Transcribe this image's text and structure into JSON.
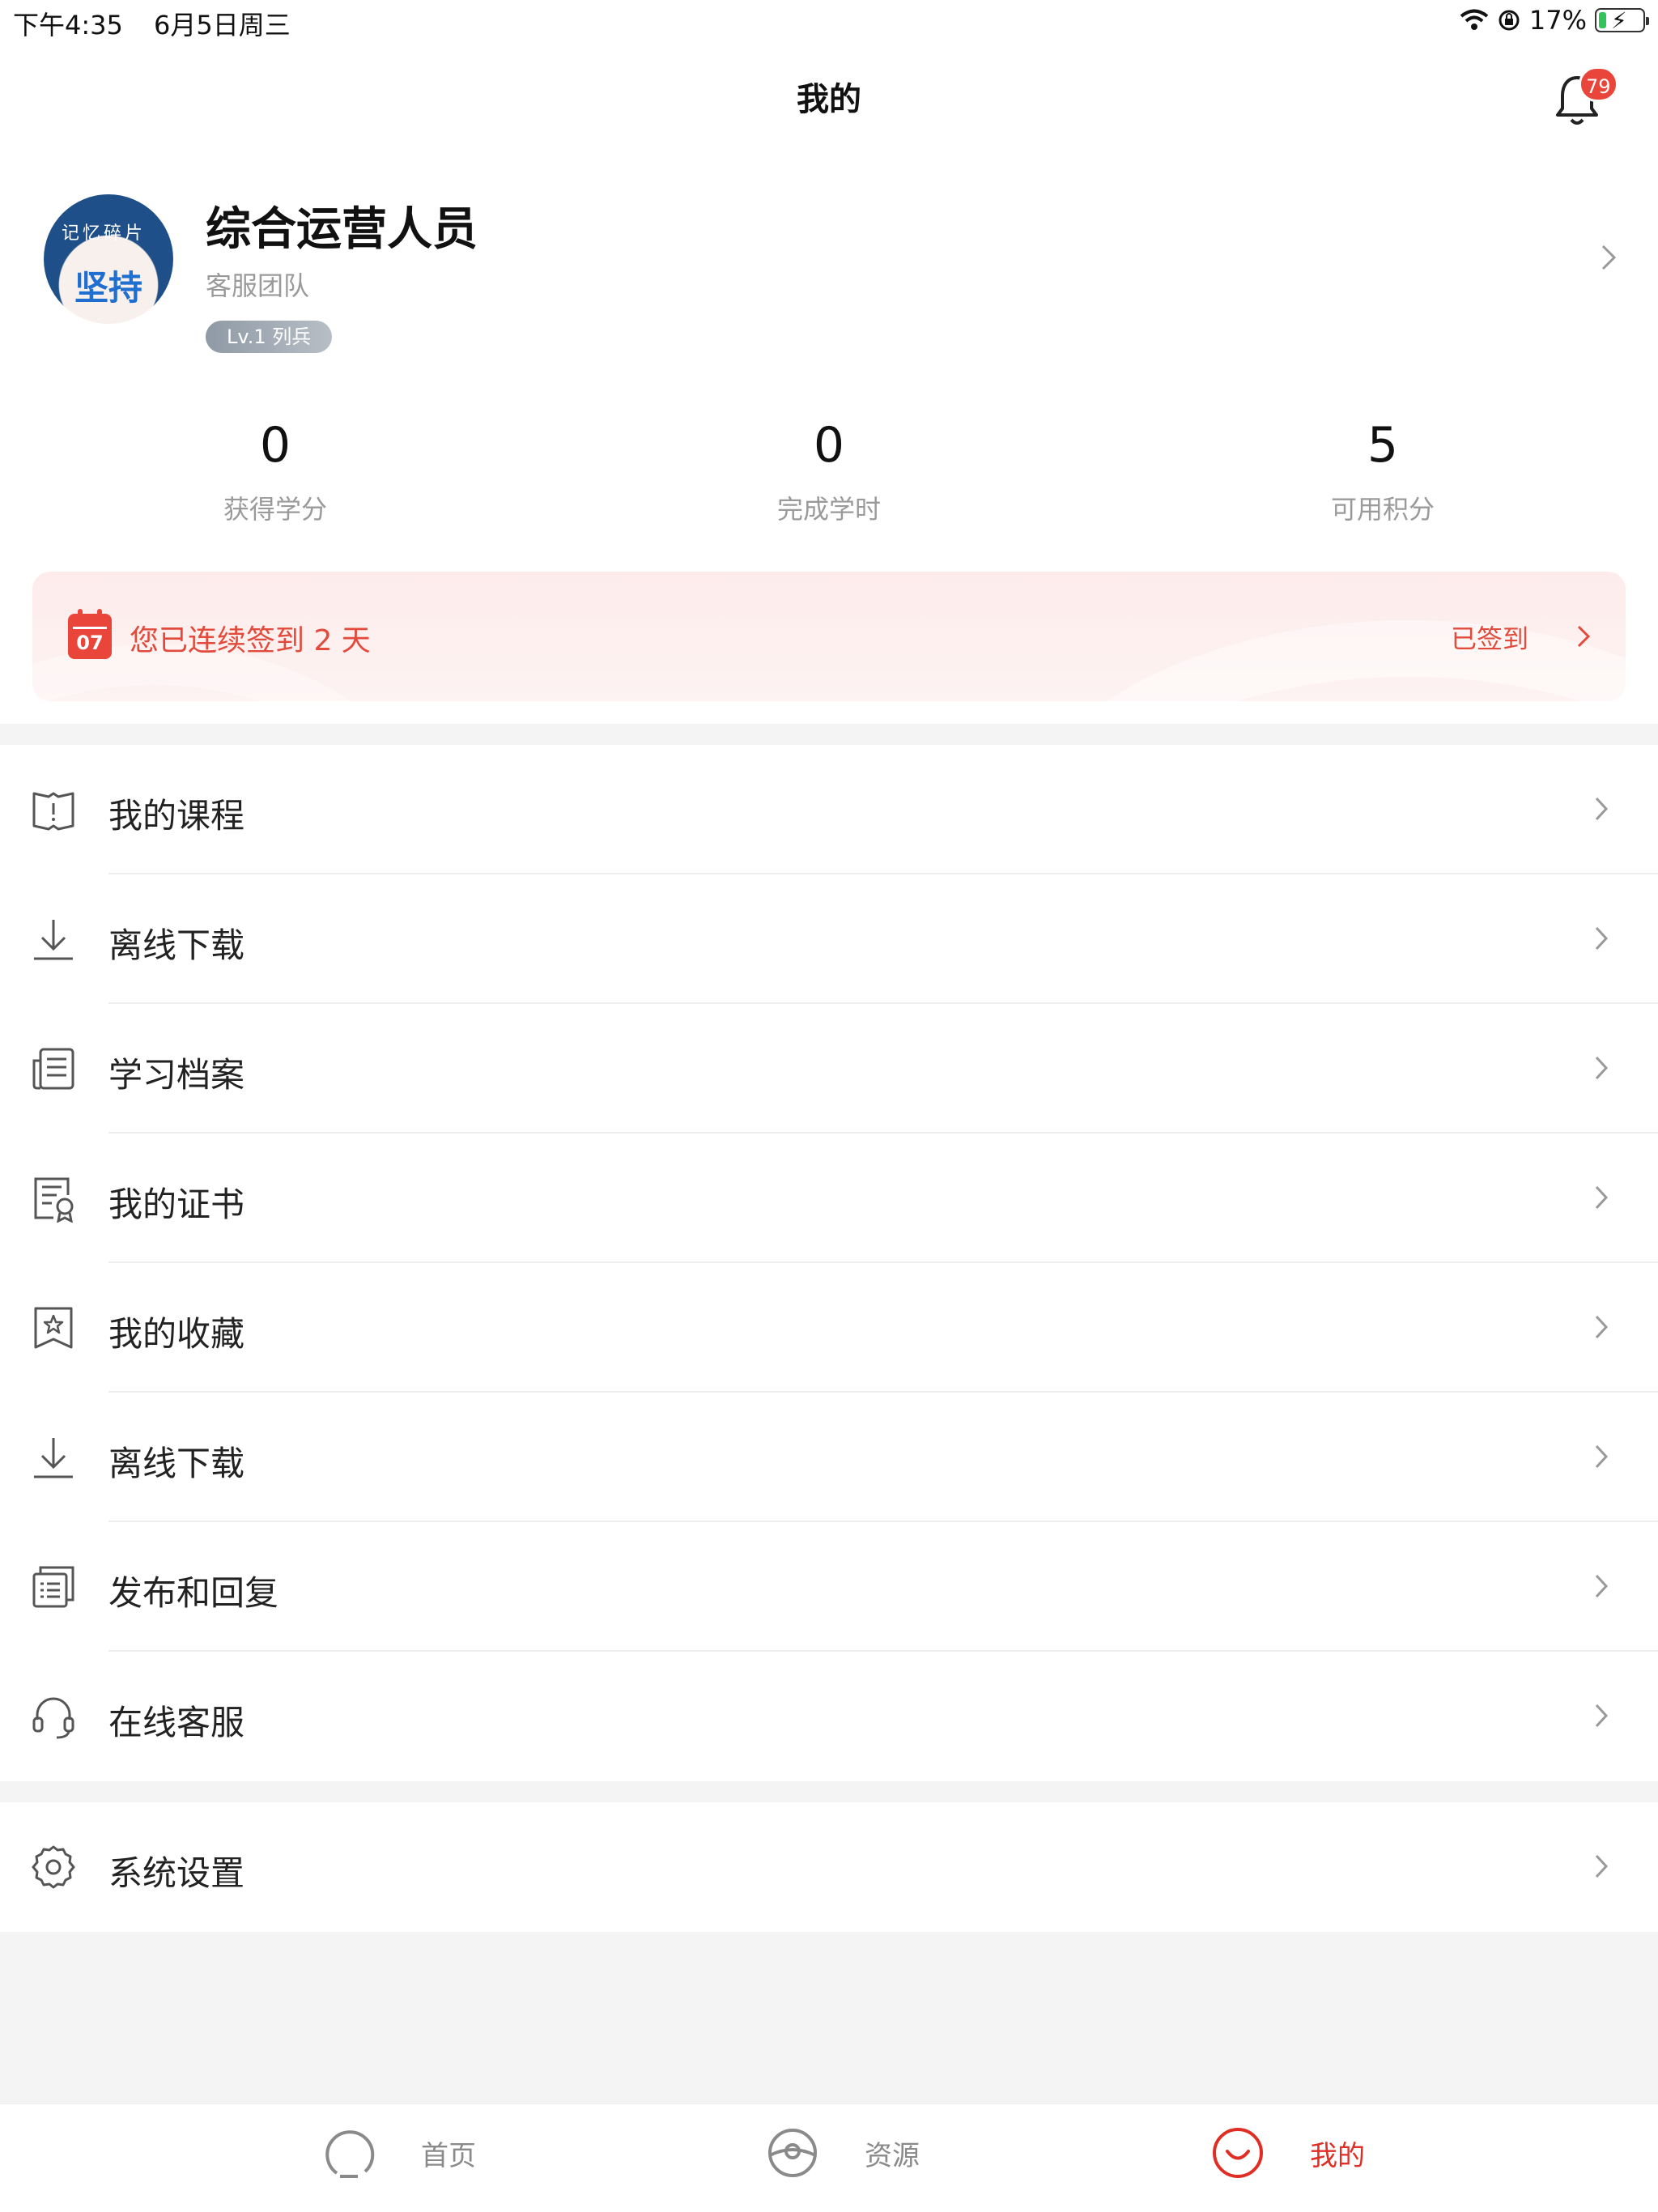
{
  "status_bar": {
    "time": "下午4:35",
    "date": "6月5日周三",
    "battery": "17%",
    "battery_level": 0.17
  },
  "nav": {
    "title": "我的",
    "notification_count": "79"
  },
  "profile": {
    "name": "综合运营人员",
    "team": "客服团队",
    "level": "Lv.1 列兵",
    "avatar_caption": "记忆碎片",
    "avatar_text": "坚持"
  },
  "stats": [
    {
      "value": "0",
      "label": "获得学分"
    },
    {
      "value": "0",
      "label": "完成学时"
    },
    {
      "value": "5",
      "label": "可用积分"
    }
  ],
  "checkin": {
    "calendar_day": "07",
    "text": "您已连续签到 2 天",
    "status": "已签到"
  },
  "menu": [
    {
      "label": "我的课程",
      "icon": "book-icon"
    },
    {
      "label": "离线下载",
      "icon": "download-icon"
    },
    {
      "label": "学习档案",
      "icon": "document-icon"
    },
    {
      "label": "我的证书",
      "icon": "certificate-icon"
    },
    {
      "label": "我的收藏",
      "icon": "star-bookmark-icon"
    },
    {
      "label": "离线下载",
      "icon": "download-icon"
    },
    {
      "label": "发布和回复",
      "icon": "list-icon"
    },
    {
      "label": "在线客服",
      "icon": "headset-icon"
    }
  ],
  "settings": {
    "label": "系统设置",
    "icon": "gear-icon"
  },
  "tabs": [
    {
      "label": "首页",
      "icon": "home-circle-icon",
      "active": false
    },
    {
      "label": "资源",
      "icon": "resource-icon",
      "active": false
    },
    {
      "label": "我的",
      "icon": "smile-icon",
      "active": true
    }
  ],
  "colors": {
    "accent": "#e02e24",
    "badge": "#e9453b",
    "muted": "#9a9a9a"
  }
}
